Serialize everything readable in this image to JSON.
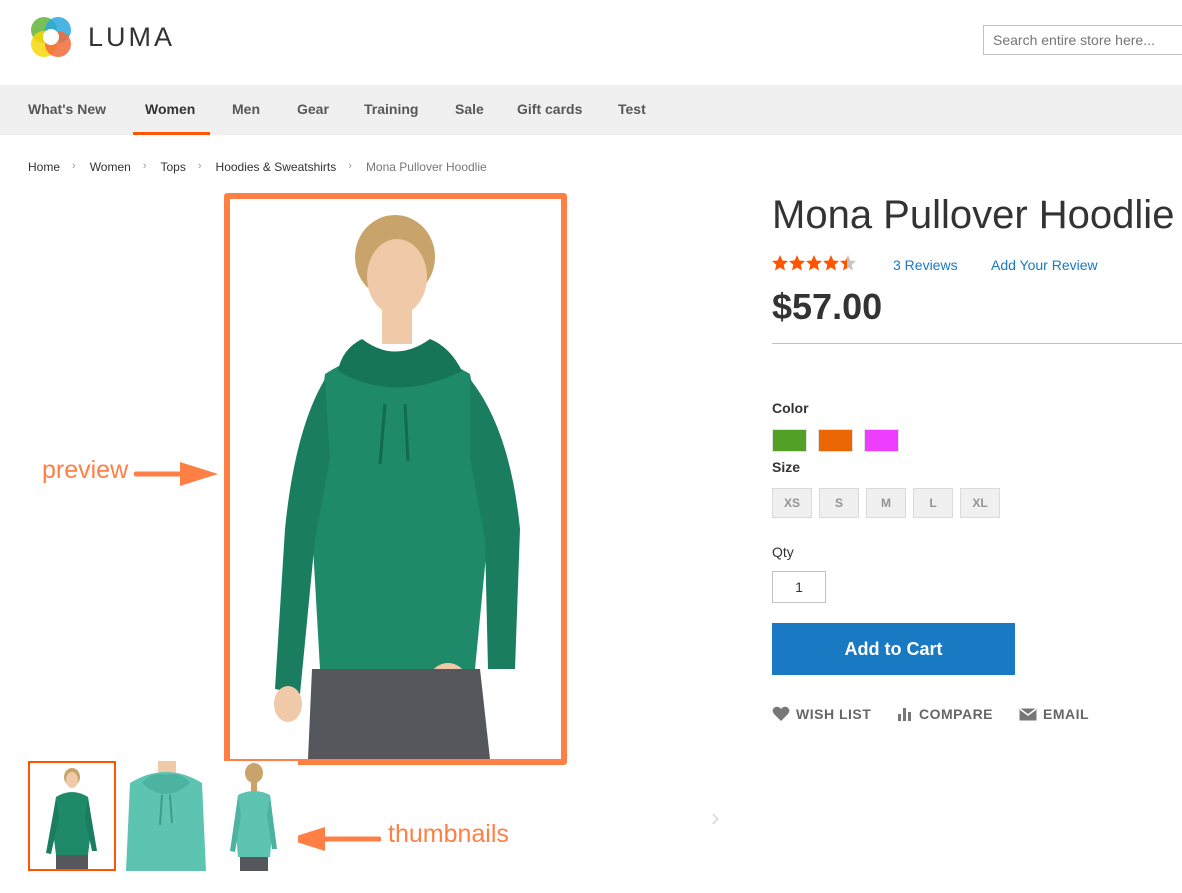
{
  "header": {
    "logo_text": "LUMA",
    "search_placeholder": "Search entire store here..."
  },
  "nav": {
    "items": [
      {
        "label": "What's New"
      },
      {
        "label": "Women",
        "active": true
      },
      {
        "label": "Men"
      },
      {
        "label": "Gear"
      },
      {
        "label": "Training"
      },
      {
        "label": "Sale"
      },
      {
        "label": "Gift cards"
      },
      {
        "label": "Test"
      }
    ]
  },
  "breadcrumb": [
    "Home",
    "Women",
    "Tops",
    "Hoodies & Sweatshirts",
    "Mona Pullover Hoodlie"
  ],
  "annotations": {
    "preview": "preview",
    "thumbnails": "thumbnails"
  },
  "product": {
    "title": "Mona Pullover Hoodlie",
    "rating": 4.3,
    "reviews_link": "3 Reviews",
    "add_review_link": "Add Your Review",
    "price": "$57.00",
    "color_label": "Color",
    "colors": [
      "#53a026",
      "#eb6703",
      "#ef3dff"
    ],
    "size_label": "Size",
    "sizes": [
      "XS",
      "S",
      "M",
      "L",
      "XL"
    ],
    "qty_label": "Qty",
    "qty_value": "1",
    "add_to_cart": "Add to Cart",
    "actions": {
      "wishlist": "WISH LIST",
      "compare": "COMPARE",
      "email": "EMAIL"
    }
  },
  "colors": {
    "accent": "#ff5501",
    "annotation": "#ff7f45",
    "link": "#1979c3",
    "garment": "#1e8a6a"
  }
}
